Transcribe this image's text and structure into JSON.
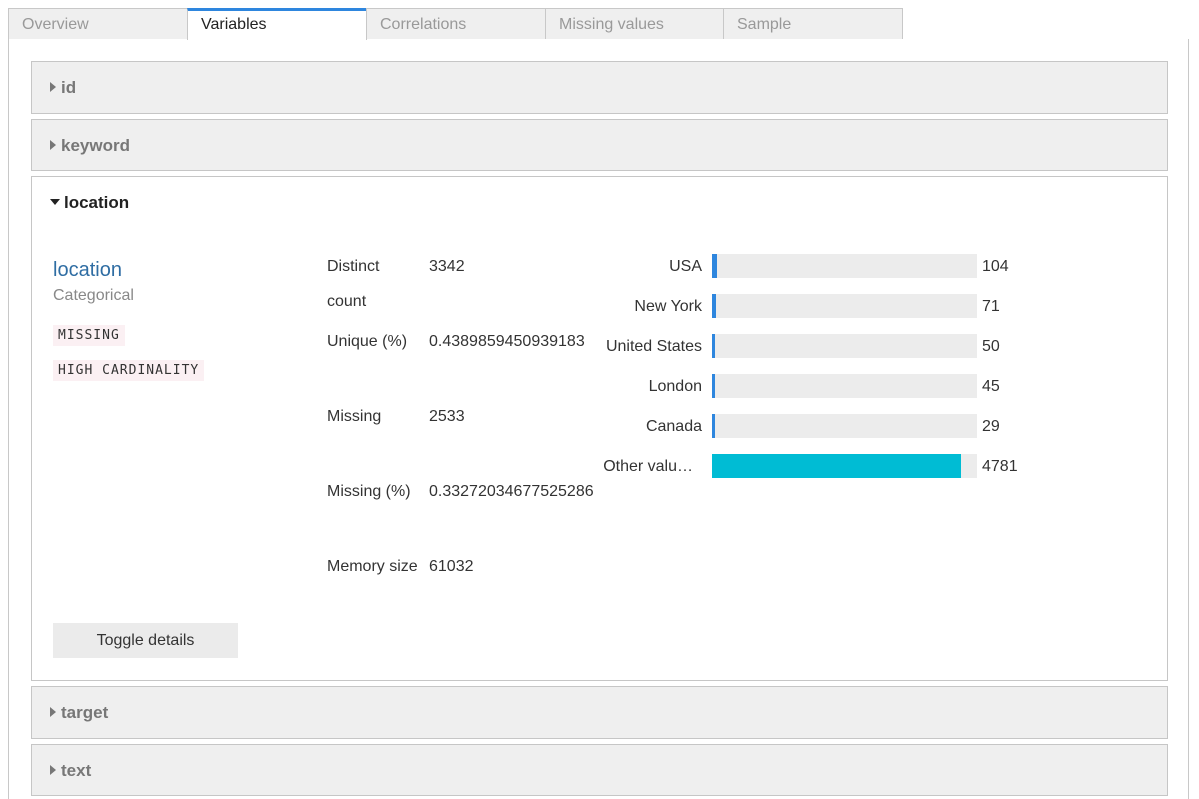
{
  "tabs": [
    {
      "label": "Overview"
    },
    {
      "label": "Variables"
    },
    {
      "label": "Correlations"
    },
    {
      "label": "Missing values"
    },
    {
      "label": "Sample"
    }
  ],
  "variables": {
    "id": {
      "label": "id"
    },
    "keyword": {
      "label": "keyword"
    },
    "location": {
      "label": "location",
      "name": "location",
      "type": "Categorical",
      "badges": [
        "MISSING",
        "HIGH CARDINALITY"
      ],
      "stats": {
        "distinct_label_1": "Distinct",
        "distinct_label_2": "count",
        "distinct_value": "3342",
        "unique_label": "Unique (%)",
        "unique_value": "0.4389859450939183",
        "missing_label": "Missing",
        "missing_value": "2533",
        "missing_pct_label": "Missing (%)",
        "missing_pct_value": "0.33272034677525286",
        "memory_label": "Memory size",
        "memory_value": "61032"
      },
      "top_values": [
        {
          "label": "USA",
          "count": "104",
          "fraction": 0.0218
        },
        {
          "label": "New York",
          "count": "71",
          "fraction": 0.0149
        },
        {
          "label": "United States",
          "count": "50",
          "fraction": 0.0105
        },
        {
          "label": "London",
          "count": "45",
          "fraction": 0.0094
        },
        {
          "label": "Canada",
          "count": "29",
          "fraction": 0.0061
        },
        {
          "label": "Other valu…",
          "count": "4781",
          "fraction": 1.0
        }
      ],
      "toggle_label": "Toggle details"
    },
    "target": {
      "label": "target"
    },
    "text": {
      "label": "text"
    }
  },
  "colors": {
    "bar": "#2e86de",
    "other_bar": "#00bcd4",
    "accent": "#2f6da3"
  }
}
